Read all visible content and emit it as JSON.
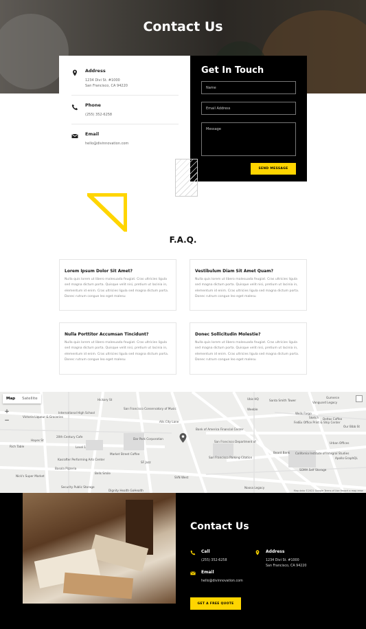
{
  "hero": {
    "title": "Contact Us"
  },
  "info": {
    "address_label": "Address",
    "address_lines": [
      "1234 Divi St. #1000",
      "San Francisco, CA 94220"
    ],
    "phone_label": "Phone",
    "phone": "(255) 352-6258",
    "email_label": "Email",
    "email": "hello@divinnovation.com"
  },
  "form": {
    "title": "Get In Touch",
    "name_placeholder": "Name",
    "email_placeholder": "Email Address",
    "message_placeholder": "Message",
    "submit_label": "SEND MESSAGE"
  },
  "faq": {
    "title": "F.A.Q.",
    "items": [
      {
        "q": "Lorem Ipsum Dolor Sit Amet?",
        "a": "Nulla quis lorem ut libero malesuada feugiat. Cras ultricies ligula sed magna dictum porta. Quisque velit nisi, pretium ut lacinia in, elementum id enim. Cras ultricies ligula sed magna dictum porta. Donec rutrum congue leo eget malesu"
      },
      {
        "q": "Vestibulum Diam Sit Amet Quam?",
        "a": "Nulla quis lorem ut libero malesuada feugiat. Cras ultricies ligula sed magna dictum porta. Quisque velit nisi, pretium ut lacinia in, elementum id enim. Cras ultricies ligula sed magna dictum porta. Donec rutrum congue leo eget malesu"
      },
      {
        "q": "Nulla Porttitor Accumsan Tincidunt?",
        "a": "Nulla quis lorem ut libero malesuada feugiat. Cras ultricies ligula sed magna dictum porta. Quisque velit nisi, pretium ut lacinia in, elementum id enim. Cras ultricies ligula sed magna dictum porta. Donec rutrum congue leo eget malesu"
      },
      {
        "q": "Donec Sollicitudin Molestie?",
        "a": "Nulla quis lorem ut libero malesuada feugiat. Cras ultricies ligula sed magna dictum porta. Quisque velit nisi, pretium ut lacinia in, elementum id enim. Cras ultricies ligula sed magna dictum porta. Donec rutrum congue leo eget malesu"
      }
    ]
  },
  "map": {
    "tab_map": "Map",
    "tab_satellite": "Satellite",
    "zoom_in": "+",
    "zoom_out": "−",
    "labels": [
      "Hickory St",
      "San Francisco Conservatory of Music",
      "Victoria Liqueur & Groceries",
      "International High School",
      "Alls City Lane",
      "20th Century Cafe",
      "Hayes St",
      "Rich Table",
      "Kasrafter Performing Arts Center",
      "Basola Pizzeria",
      "Nick's Super Market",
      "Market Street Coffee",
      "Bells Smile",
      "Dar Park Corporation",
      "Bank of America Financial Center",
      "San Francisco Department of",
      "San Francisco Parking Citation",
      "SVN West",
      "SF Jazz",
      "Security Public Storage",
      "Dignity Health GoHealth",
      "Noosa Legacy",
      "Weeble",
      "Sketch",
      "Vanguard Legacy",
      "Wells Fargo",
      "FedEx Office Print & Ship Center",
      "Urban Offices",
      "Deltas Coffee",
      "California Institute of Integral Studies",
      "SOMA Self Storage",
      "Apollo GraphQL",
      "Gumerce",
      "Ubis HQ",
      "Santa Smith Tower",
      "Beard Bank",
      "Our Bibb St",
      "Level 1"
    ],
    "footer": "Map data ©2021 Google  Terms of Use  Report a map error"
  },
  "footer": {
    "title": "Contact Us",
    "call_label": "Call",
    "phone": "(255) 352-6258",
    "email_label": "Email",
    "email": "hello@divinnovation.com",
    "address_label": "Address",
    "address_lines": [
      "1234 Divi St. #1000",
      "San Francisco, CA 94220"
    ],
    "cta_label": "GET A FREE QUOTE"
  },
  "colors": {
    "accent": "#ffd500",
    "dark": "#000000"
  }
}
